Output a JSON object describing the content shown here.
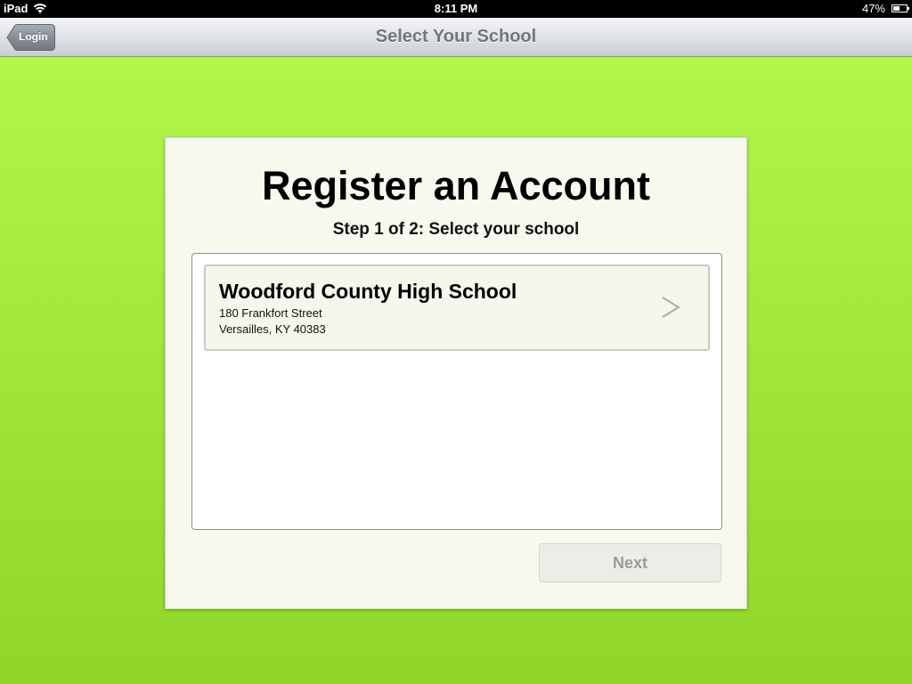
{
  "status_bar": {
    "device": "iPad",
    "time": "8:11 PM",
    "battery": "47%",
    "battery_level": 0.47
  },
  "nav_bar": {
    "title": "Select Your School",
    "back_label": "Login"
  },
  "registration": {
    "title": "Register an Account",
    "step": "Step 1 of 2: Select your school",
    "schools": [
      {
        "name": "Woodford County High School",
        "street": "180 Frankfort Street",
        "city": "Versailles, KY 40383"
      }
    ],
    "next_label": "Next"
  },
  "colors": {
    "background_green": "#a2e83c",
    "card": "#f7f9ef",
    "nav_title": "#6f7780",
    "disabled_text": "#9a9c98"
  },
  "icons": {
    "wifi": "wifi-icon",
    "battery": "battery-icon",
    "back": "back-arrow-button",
    "chevron": "chevron-right-icon"
  }
}
